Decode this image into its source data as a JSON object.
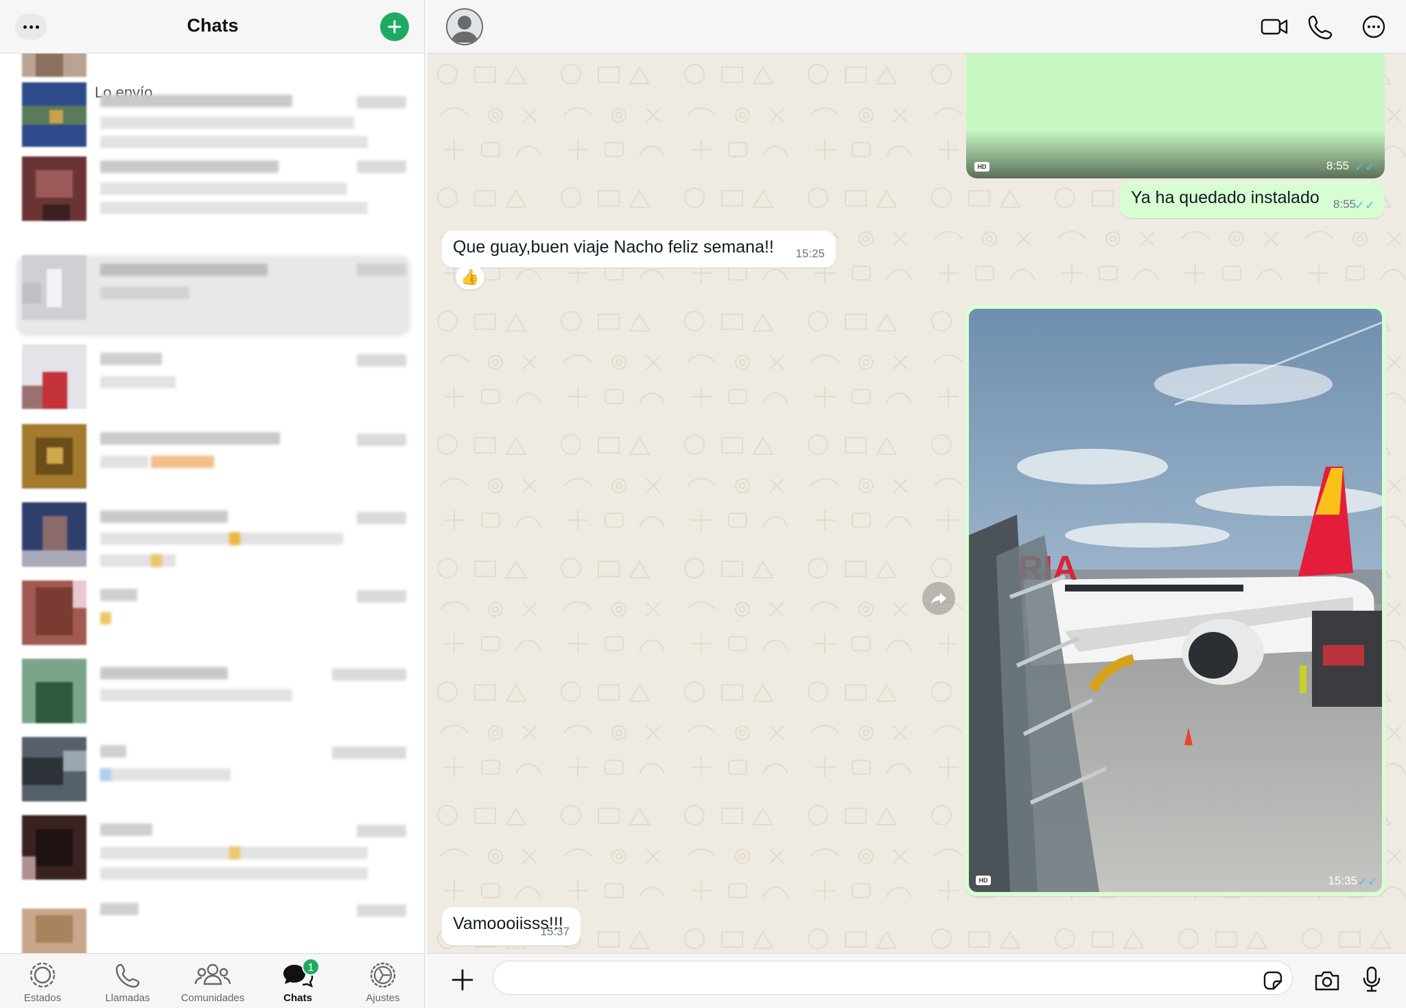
{
  "left_pane": {
    "title": "Chats",
    "first_row_preview": "Lo envío"
  },
  "tabbar": {
    "tabs": [
      {
        "label": "Estados",
        "icon": "status-icon"
      },
      {
        "label": "Llamadas",
        "icon": "phone-icon"
      },
      {
        "label": "Comunidades",
        "icon": "communities-icon"
      },
      {
        "label": "Chats",
        "icon": "chats-icon",
        "active": true,
        "badge": "1"
      },
      {
        "label": "Ajustes",
        "icon": "settings-icon"
      }
    ]
  },
  "conversation": {
    "header_icons": [
      "video-call-icon",
      "phone-icon",
      "more-options-icon"
    ],
    "messages": [
      {
        "type": "media",
        "direction": "out",
        "time": "8:55",
        "badge": "HD"
      },
      {
        "type": "text",
        "direction": "out",
        "text": "Ya ha quedado instalado",
        "time": "8:55"
      },
      {
        "type": "text",
        "direction": "in",
        "text": "Que guay,buen viaje Nacho feliz semana!!",
        "time": "15:25",
        "reaction": "👍"
      },
      {
        "type": "photo",
        "direction": "out",
        "time": "15:35",
        "badge": "HD",
        "photo_text": "RIA"
      },
      {
        "type": "text",
        "direction": "in",
        "text": "Vamoooiisss!!!",
        "time": "15:37"
      }
    ]
  },
  "composer": {
    "placeholder": ""
  },
  "colors": {
    "accent": "#1dab61",
    "outgoing_bubble": "#d9fdd3",
    "incoming_bubble": "#ffffff",
    "wallpaper": "#efeae2",
    "read_ticks": "#53bdeb"
  }
}
